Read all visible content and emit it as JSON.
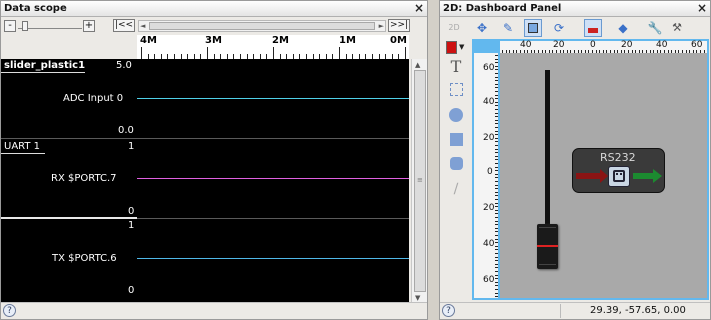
{
  "scope": {
    "title": "Data scope",
    "close": "×",
    "minus": "-",
    "plus": "+",
    "first": "|<<",
    "last": ">>|",
    "left_arrow": "◄",
    "right_arrow": "►",
    "time_labels": [
      "4M",
      "3M",
      "2M",
      "1M",
      "0M"
    ],
    "channels": [
      {
        "group": "slider_plastic1",
        "name": "ADC Input 0",
        "max": "5.0",
        "min": "0.0",
        "color": "#4fd0e8"
      },
      {
        "group": "UART 1",
        "name": "RX $PORTC.7",
        "max": "1",
        "min": "0",
        "color": "#e060e0"
      },
      {
        "group": "",
        "name": "TX $PORTC.6",
        "max": "1",
        "min": "0",
        "color": "#4fb8e8"
      }
    ],
    "help": "?"
  },
  "dashboard": {
    "title": "2D: Dashboard Panel",
    "close": "×",
    "tool_2d": "2D",
    "text_tool": "T",
    "h_ruler_labels": [
      "40",
      "20",
      "0",
      "20",
      "40",
      "60"
    ],
    "v_ruler_labels": [
      "60",
      "40",
      "20",
      "0",
      "20",
      "40",
      "60"
    ],
    "rs232_label": "RS232",
    "status_coords": "29.39, -57.65, 0.00",
    "help": "?",
    "accent_color": "#cc1111",
    "canvas_bg": "#a9a9a9",
    "canvas_border": "#62b8ee"
  }
}
